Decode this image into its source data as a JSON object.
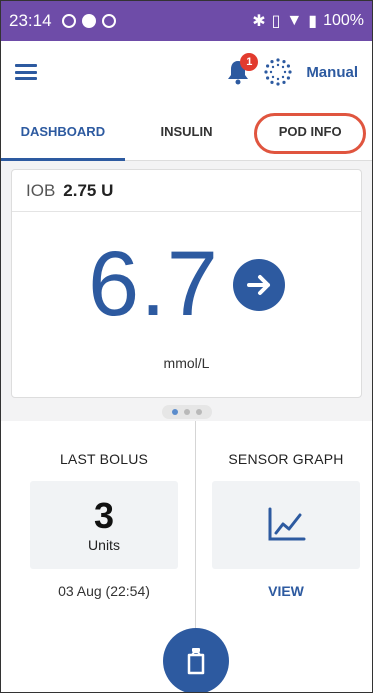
{
  "status_bar": {
    "time": "23:14",
    "battery": "100%"
  },
  "header": {
    "notification_count": "1",
    "mode_label": "Manual"
  },
  "tabs": [
    {
      "label": "DASHBOARD"
    },
    {
      "label": "INSULIN"
    },
    {
      "label": "POD INFO"
    }
  ],
  "dashboard": {
    "iob_label": "IOB",
    "iob_value": "2.75 U",
    "glucose_value": "6.7",
    "glucose_unit": "mmol/L"
  },
  "last_bolus": {
    "title": "LAST BOLUS",
    "value": "3",
    "unit": "Units",
    "date": "03 Aug (22:54)"
  },
  "sensor_graph": {
    "title": "SENSOR GRAPH",
    "link": "VIEW"
  },
  "colors": {
    "status_bar": "#6e4ca8",
    "accent": "#2d5aa0",
    "badge": "#e23b2e",
    "highlight_ring": "#e0553f"
  },
  "icons": {
    "menu": "hamburger-menu-icon",
    "notification": "bell-icon",
    "pod_status": "pod-status-icon",
    "trend": "arrow-right-icon",
    "graph": "line-graph-icon",
    "fab": "pod-icon"
  }
}
